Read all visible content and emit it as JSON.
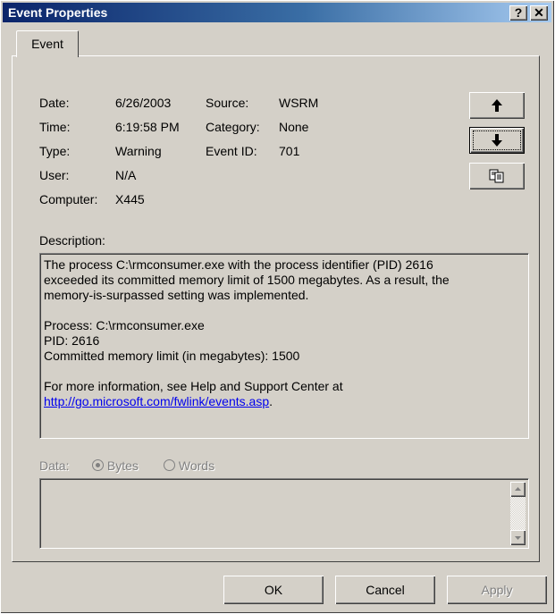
{
  "window": {
    "title": "Event Properties",
    "help_label": "?",
    "close_label": "✕"
  },
  "tabs": [
    {
      "label": "Event"
    }
  ],
  "fields": {
    "date": {
      "label": "Date:",
      "value": "6/26/2003"
    },
    "time": {
      "label": "Time:",
      "value": "6:19:58 PM"
    },
    "type": {
      "label": "Type:",
      "value": "Warning"
    },
    "user": {
      "label": "User:",
      "value": "N/A"
    },
    "computer": {
      "label": "Computer:",
      "value": "X445"
    },
    "source": {
      "label": "Source:",
      "value": "WSRM"
    },
    "category": {
      "label": "Category:",
      "value": "None"
    },
    "event_id": {
      "label": "Event ID:",
      "value": "701"
    }
  },
  "nav_buttons": {
    "up_icon": "arrow-up-icon",
    "down_icon": "arrow-down-icon",
    "copy_icon": "copy-icon"
  },
  "description": {
    "label": "Description:",
    "lines": [
      "The process C:\\rmconsumer.exe with the process identifier (PID) 2616",
      "exceeded its committed memory limit of 1500 megabytes. As a result, the",
      "memory-is-surpassed setting was implemented.",
      "Process: C:\\rmconsumer.exe",
      "PID: 2616",
      "Committed memory limit (in megabytes): 1500",
      "For more information, see Help and Support Center at"
    ],
    "link": "http://go.microsoft.com/fwlink/events.asp",
    "link_suffix": "."
  },
  "data_section": {
    "label": "Data:",
    "bytes_label": "Bytes",
    "words_label": "Words",
    "selected": "Bytes"
  },
  "footer": {
    "ok_label": "OK",
    "cancel_label": "Cancel",
    "apply_label": "Apply"
  }
}
